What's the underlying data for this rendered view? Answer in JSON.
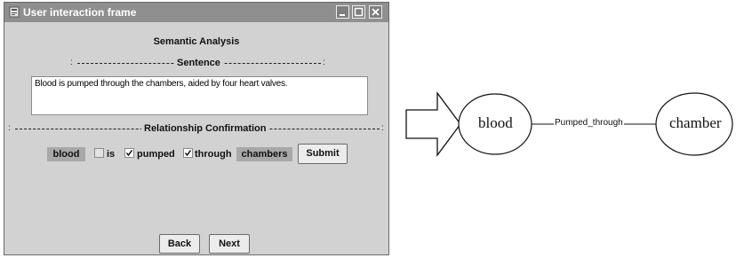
{
  "window": {
    "title": "User interaction frame",
    "heading": "Semantic Analysis",
    "sentence_section": {
      "label": "Sentence",
      "left_tick": ":",
      "right_tick": ":",
      "text": "Blood is pumped through the chambers, aided by four heart valves."
    },
    "relationship_section": {
      "label": "Relationship Confirmation",
      "left_tick": ":",
      "right_tick": ":",
      "words": [
        {
          "text": "blood"
        },
        {
          "text": "is",
          "checked": false
        },
        {
          "text": "pumped",
          "checked": true
        },
        {
          "text": "through",
          "checked": true
        },
        {
          "text": "chambers"
        }
      ],
      "submit_label": "Submit"
    },
    "back_label": "Back",
    "next_label": "Next"
  },
  "diagram": {
    "source_node": "blood",
    "edge_label": "Pumped_through",
    "target_node": "chamber"
  }
}
